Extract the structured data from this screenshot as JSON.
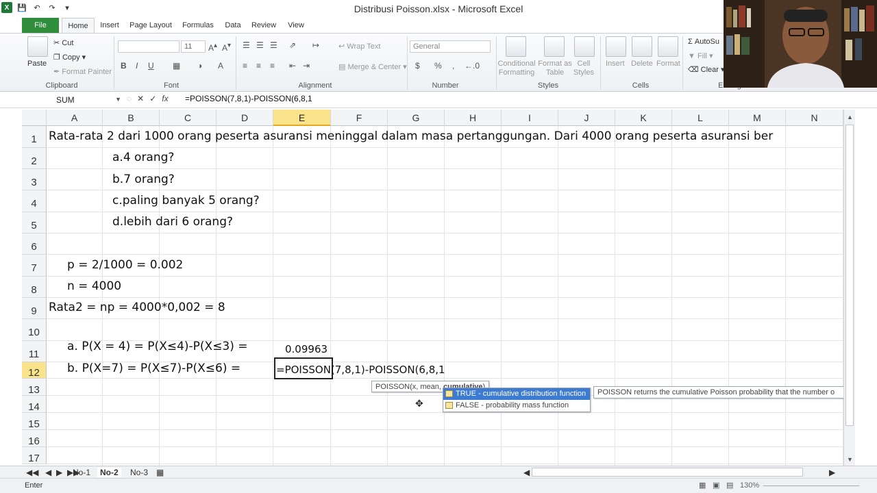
{
  "window": {
    "title": "Distribusi Poisson.xlsx - Microsoft Excel"
  },
  "ribbon_tabs": [
    "File",
    "Home",
    "Insert",
    "Page Layout",
    "Formulas",
    "Data",
    "Review",
    "View"
  ],
  "ribbon": {
    "clipboard": {
      "paste": "Paste",
      "cut": "Cut",
      "copy": "Copy",
      "format_painter": "Format Painter",
      "label": "Clipboard"
    },
    "font": {
      "size": "11",
      "label": "Font"
    },
    "alignment": {
      "wrap_text": "Wrap Text",
      "merge_center": "Merge & Center",
      "label": "Alignment"
    },
    "number": {
      "format": "General",
      "currency": "$",
      "percent": "%",
      "comma": ",",
      "label": "Number"
    },
    "styles": {
      "conditional": "Conditional Formatting",
      "format_table": "Format as Table",
      "cell_styles": "Cell Styles",
      "label": "Styles"
    },
    "cells": {
      "insert": "Insert",
      "delete": "Delete",
      "format": "Format",
      "label": "Cells"
    },
    "editing": {
      "autosum": "AutoSu",
      "fill": "Fill",
      "clear": "Clear",
      "label": "Editing"
    }
  },
  "formula_bar": {
    "name_box": "SUM",
    "formula": "=POISSON(7,8,1)-POISSON(6,8,1"
  },
  "columns": [
    "A",
    "B",
    "C",
    "D",
    "E",
    "F",
    "G",
    "H",
    "I",
    "J",
    "K",
    "L",
    "M",
    "N"
  ],
  "selected_column": "E",
  "rows": [
    "1",
    "2",
    "3",
    "4",
    "5",
    "6",
    "7",
    "8",
    "9",
    "10",
    "11",
    "12",
    "13",
    "14",
    "15",
    "16",
    "17"
  ],
  "selected_row": "12",
  "cells": {
    "r1": "Rata-rata 2 dari 1000 orang peserta asuransi meninggal dalam masa pertanggungan. Dari 4000 orang peserta asuransi ber",
    "r2": "a.4 orang?",
    "r3": "b.7 orang?",
    "r4": "c.paling banyak 5 orang?",
    "r5": "d.lebih dari 6 orang?",
    "r7": "p = 2/1000 = 0.002",
    "r8": "n = 4000",
    "r9": "Rata2 = np = 4000*0,002 = 8",
    "r11": "a. P(X = 4) = P(X≤4)-P(X≤3) =",
    "r11_value": "0.09963",
    "r12": "b. P(X=7) = P(X≤7)-P(X≤6) =",
    "r12_edit": "=POISSON(7,8,1)-POISSON(6,8,1"
  },
  "autocomplete": {
    "syntax_prefix": "POISSON(x, mean, ",
    "syntax_bold": "cumulative",
    "syntax_suffix": ")",
    "options": [
      "TRUE - cumulative distribution function",
      "FALSE - probability mass function"
    ],
    "description": "POISSON returns the cumulative Poisson probability that the number o"
  },
  "sheets": [
    "No-1",
    "No-2",
    "No-3"
  ],
  "active_sheet": "No-2",
  "status": "Enter",
  "zoom": "130%"
}
